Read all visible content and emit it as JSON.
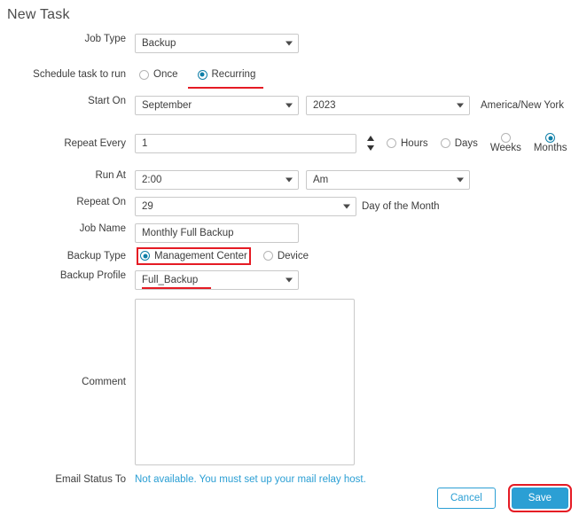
{
  "title": "New Task",
  "form": {
    "job_type": {
      "label": "Job Type",
      "value": "Backup"
    },
    "schedule": {
      "label": "Schedule task to run",
      "options": [
        {
          "label": "Once",
          "selected": false
        },
        {
          "label": "Recurring",
          "selected": true
        }
      ]
    },
    "start_on": {
      "label": "Start On",
      "month": "September",
      "year": "2023",
      "timezone": "America/New York"
    },
    "repeat_every": {
      "label": "Repeat Every",
      "value": "1",
      "units": [
        {
          "label": "Hours",
          "selected": false
        },
        {
          "label": "Days",
          "selected": false
        },
        {
          "label": "Weeks",
          "selected": false
        },
        {
          "label": "Months",
          "selected": true
        }
      ]
    },
    "run_at": {
      "label": "Run At",
      "time": "2:00",
      "meridiem": "Am"
    },
    "repeat_on": {
      "label": "Repeat On",
      "value": "29",
      "suffix": "Day of the Month"
    },
    "job_name": {
      "label": "Job Name",
      "value": "Monthly Full Backup"
    },
    "backup_type": {
      "label": "Backup Type",
      "options": [
        {
          "label": "Management Center",
          "selected": true
        },
        {
          "label": "Device",
          "selected": false
        }
      ]
    },
    "backup_profile": {
      "label": "Backup Profile",
      "value": "Full_Backup"
    },
    "comment": {
      "label": "Comment",
      "value": "",
      "placeholder": ""
    },
    "email_status": {
      "label": "Email Status To",
      "note": "Not available. You must set up your mail relay host."
    }
  },
  "buttons": {
    "cancel": "Cancel",
    "save": "Save"
  },
  "colors": {
    "accent": "#2b9fd4",
    "radio_selected": "#0f7fa8",
    "highlight": "#e51b24",
    "link": "#2b9fd4"
  }
}
